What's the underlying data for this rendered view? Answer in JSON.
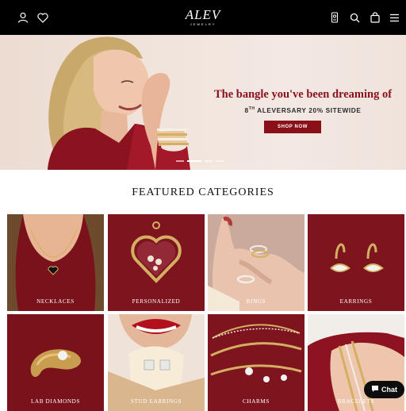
{
  "header": {
    "logo_main": "ALEV",
    "logo_sub": "JEWELRY",
    "icons": [
      "account-icon",
      "wishlist-heart-icon",
      "store-location-icon",
      "search-icon",
      "cart-bag-icon",
      "hamburger-menu-icon"
    ]
  },
  "hero": {
    "headline": "The bangle you've been dreaming of",
    "subline_prefix": "8",
    "subline_sup": "TH",
    "subline_rest": " ALEVERSARY 20% SITEWIDE",
    "button_label": "SHOP NOW",
    "slide_count": 4,
    "active_slide": 2
  },
  "featured": {
    "title": "FEATURED CATEGORIES",
    "categories": [
      {
        "label": "NECKLACES"
      },
      {
        "label": "PERSONALIZED"
      },
      {
        "label": "RINGS"
      },
      {
        "label": "EARRINGS"
      },
      {
        "label": "LAB DIAMONDS"
      },
      {
        "label": "STUD EARRINGS"
      },
      {
        "label": "CHARMS"
      },
      {
        "label": "BRACELETS"
      }
    ]
  },
  "chat": {
    "label": "Chat"
  },
  "colors": {
    "brand_red": "#8a0f18",
    "header_bg": "#000000",
    "gold": "#d4af63"
  }
}
